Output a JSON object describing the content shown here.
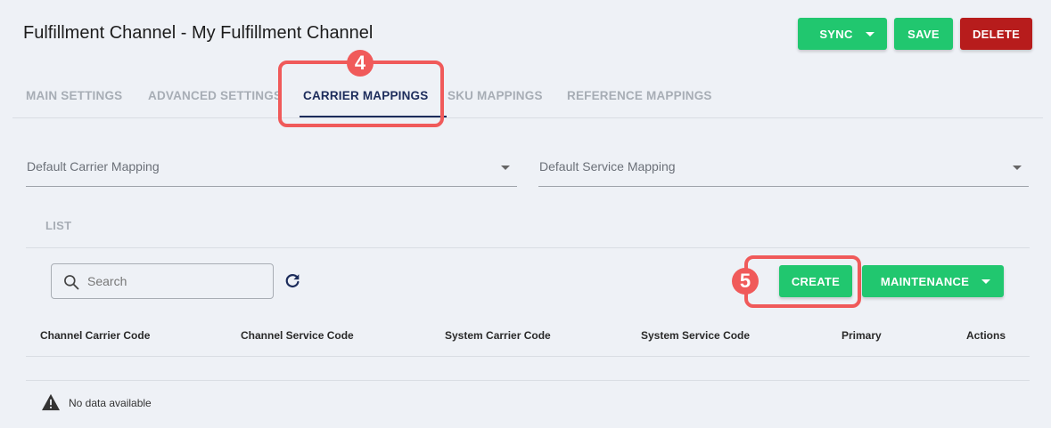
{
  "header": {
    "title": "Fulfillment Channel - My Fulfillment Channel",
    "actions": {
      "sync_label": "SYNC",
      "save_label": "SAVE",
      "delete_label": "DELETE"
    }
  },
  "tabs": [
    {
      "label": "MAIN SETTINGS"
    },
    {
      "label": "ADVANCED SETTINGS"
    },
    {
      "label": "CARRIER MAPPINGS"
    },
    {
      "label": "SKU MAPPINGS"
    },
    {
      "label": "REFERENCE MAPPINGS"
    }
  ],
  "annotations": {
    "step_tab": "4",
    "step_create": "5",
    "highlight_color": "#f05a5a"
  },
  "defaults": {
    "carrier_label": "Default Carrier Mapping",
    "service_label": "Default Service Mapping"
  },
  "list": {
    "label": "LIST",
    "search_placeholder": "Search",
    "create_label": "CREATE",
    "maintenance_label": "MAINTENANCE",
    "columns": [
      "Channel Carrier Code",
      "Channel Service Code",
      "System Carrier Code",
      "System Service Code",
      "Primary",
      "Actions"
    ],
    "empty_text": "No data available"
  },
  "colors": {
    "primary_green": "#21c76f",
    "danger_red": "#b71c1c",
    "active_tab": "#1c2c5b",
    "background": "#eef1f6"
  }
}
